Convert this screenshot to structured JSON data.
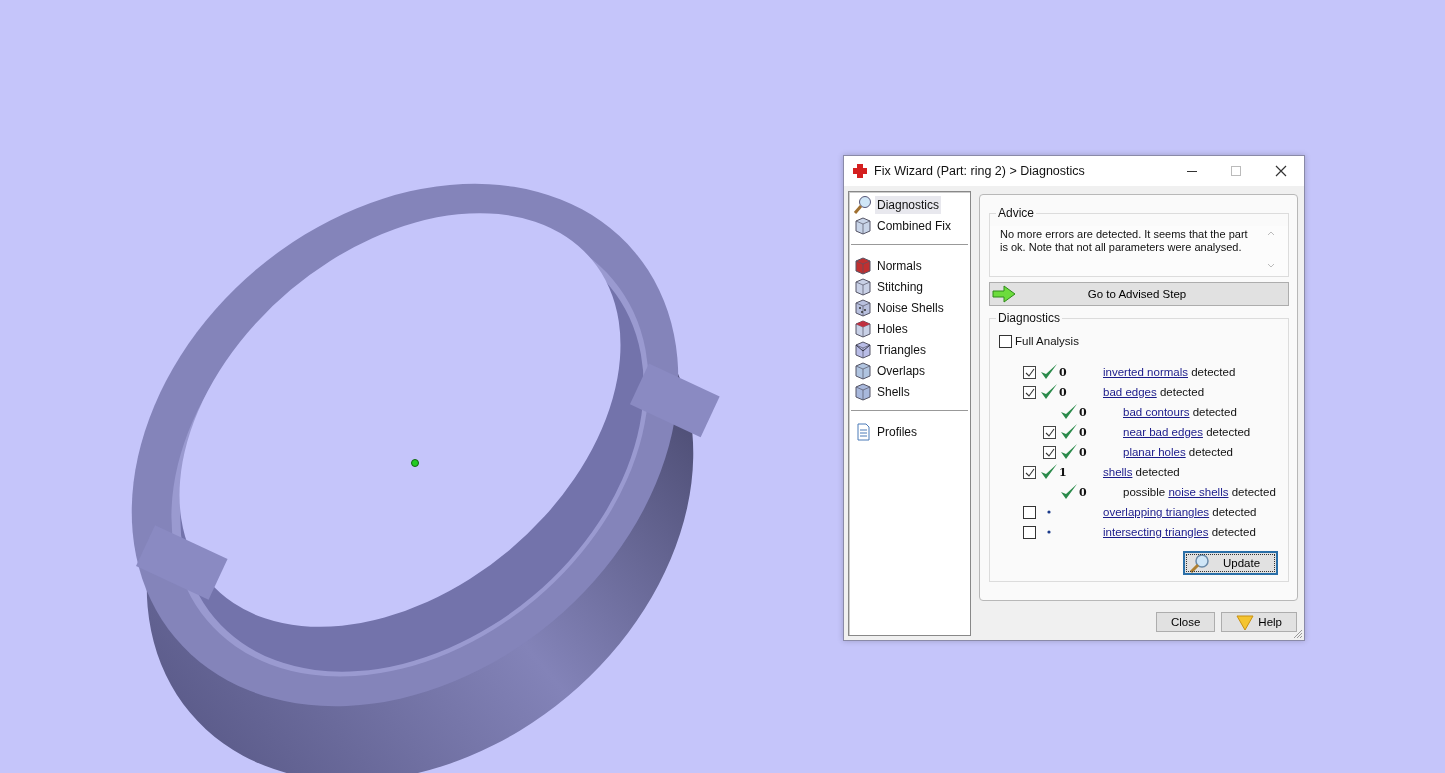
{
  "window": {
    "title": "Fix Wizard (Part: ring 2) > Diagnostics"
  },
  "sidebar": {
    "groups": [
      [
        {
          "label": "Diagnostics",
          "selected": true
        },
        {
          "label": "Combined Fix",
          "selected": false
        }
      ],
      [
        {
          "label": "Normals",
          "selected": false
        },
        {
          "label": "Stitching",
          "selected": false
        },
        {
          "label": "Noise Shells",
          "selected": false
        },
        {
          "label": "Holes",
          "selected": false
        },
        {
          "label": "Triangles",
          "selected": false
        },
        {
          "label": "Overlaps",
          "selected": false
        },
        {
          "label": "Shells",
          "selected": false
        }
      ],
      [
        {
          "label": "Profiles",
          "selected": false
        }
      ]
    ]
  },
  "advice": {
    "legend": "Advice",
    "text": "No more errors are detected. It seems that the part is ok. Note that not all parameters were analysed."
  },
  "advised_step_button": "Go to Advised Step",
  "diagnostics": {
    "legend": "Diagnostics",
    "full_analysis": {
      "label": "Full Analysis",
      "checked": false
    },
    "rows": [
      {
        "kind": "check",
        "checked": true,
        "count": "0",
        "link": "inverted normals",
        "suffix": "detected"
      },
      {
        "kind": "check",
        "checked": true,
        "count": "0",
        "link": "bad edges",
        "suffix": "detected",
        "children": [
          {
            "kind": "check",
            "count": "0",
            "link": "bad contours",
            "suffix": "detected"
          },
          {
            "kind": "check",
            "checked": true,
            "count": "0",
            "link": "near bad edges",
            "suffix": "detected"
          },
          {
            "kind": "check",
            "checked": true,
            "count": "0",
            "link": "planar holes",
            "suffix": "detected"
          }
        ]
      },
      {
        "kind": "check",
        "checked": true,
        "count": "1",
        "link": "shells",
        "suffix": "detected",
        "children": [
          {
            "kind": "check",
            "count": "0",
            "prefix": "possible",
            "link": "noise shells",
            "suffix": "detected"
          }
        ]
      },
      {
        "kind": "dot",
        "checked": false,
        "link": "overlapping triangles",
        "suffix": "detected"
      },
      {
        "kind": "dot",
        "checked": false,
        "link": "intersecting triangles",
        "suffix": "detected"
      }
    ],
    "update_button": "Update"
  },
  "buttons": [
    {
      "label": "Close"
    },
    {
      "label": "Help"
    }
  ]
}
